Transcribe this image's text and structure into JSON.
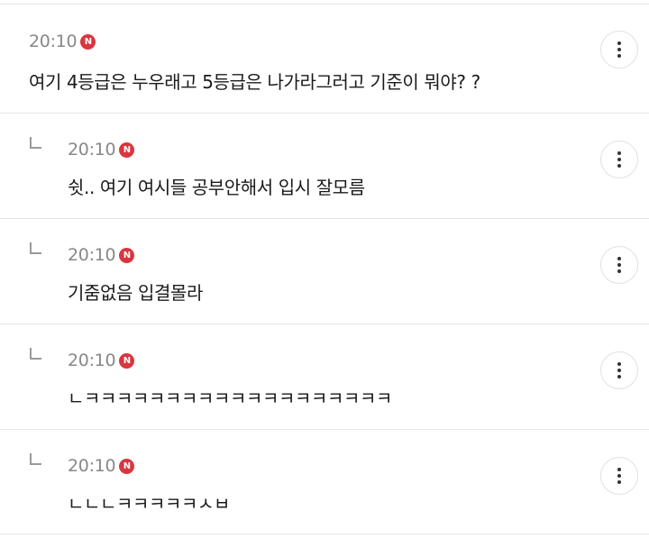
{
  "comments": [
    {
      "time": "20:10",
      "badge": "N",
      "text": "여기 4등급은 누우래고 5등급은 나가라그러고 기준이 뭐야? ?",
      "reply": false
    },
    {
      "time": "20:10",
      "badge": "N",
      "text": "쉿.. 여기 여시들 공부안해서 입시 잘모름",
      "reply": true
    },
    {
      "time": "20:10",
      "badge": "N",
      "text": "기줌없음 입결몰라",
      "reply": true
    },
    {
      "time": "20:10",
      "badge": "N",
      "text": "ㄴㅋㅋㅋㅋㅋㅋㅋㅋㅋㅋㅋㅋㅋㅋㅋㅋㅋㅋㅋ",
      "reply": true
    },
    {
      "time": "20:10",
      "badge": "N",
      "text": "ㄴㄴㄴㅋㅋㅋㅋㅋㅅㅂ",
      "reply": true
    }
  ]
}
